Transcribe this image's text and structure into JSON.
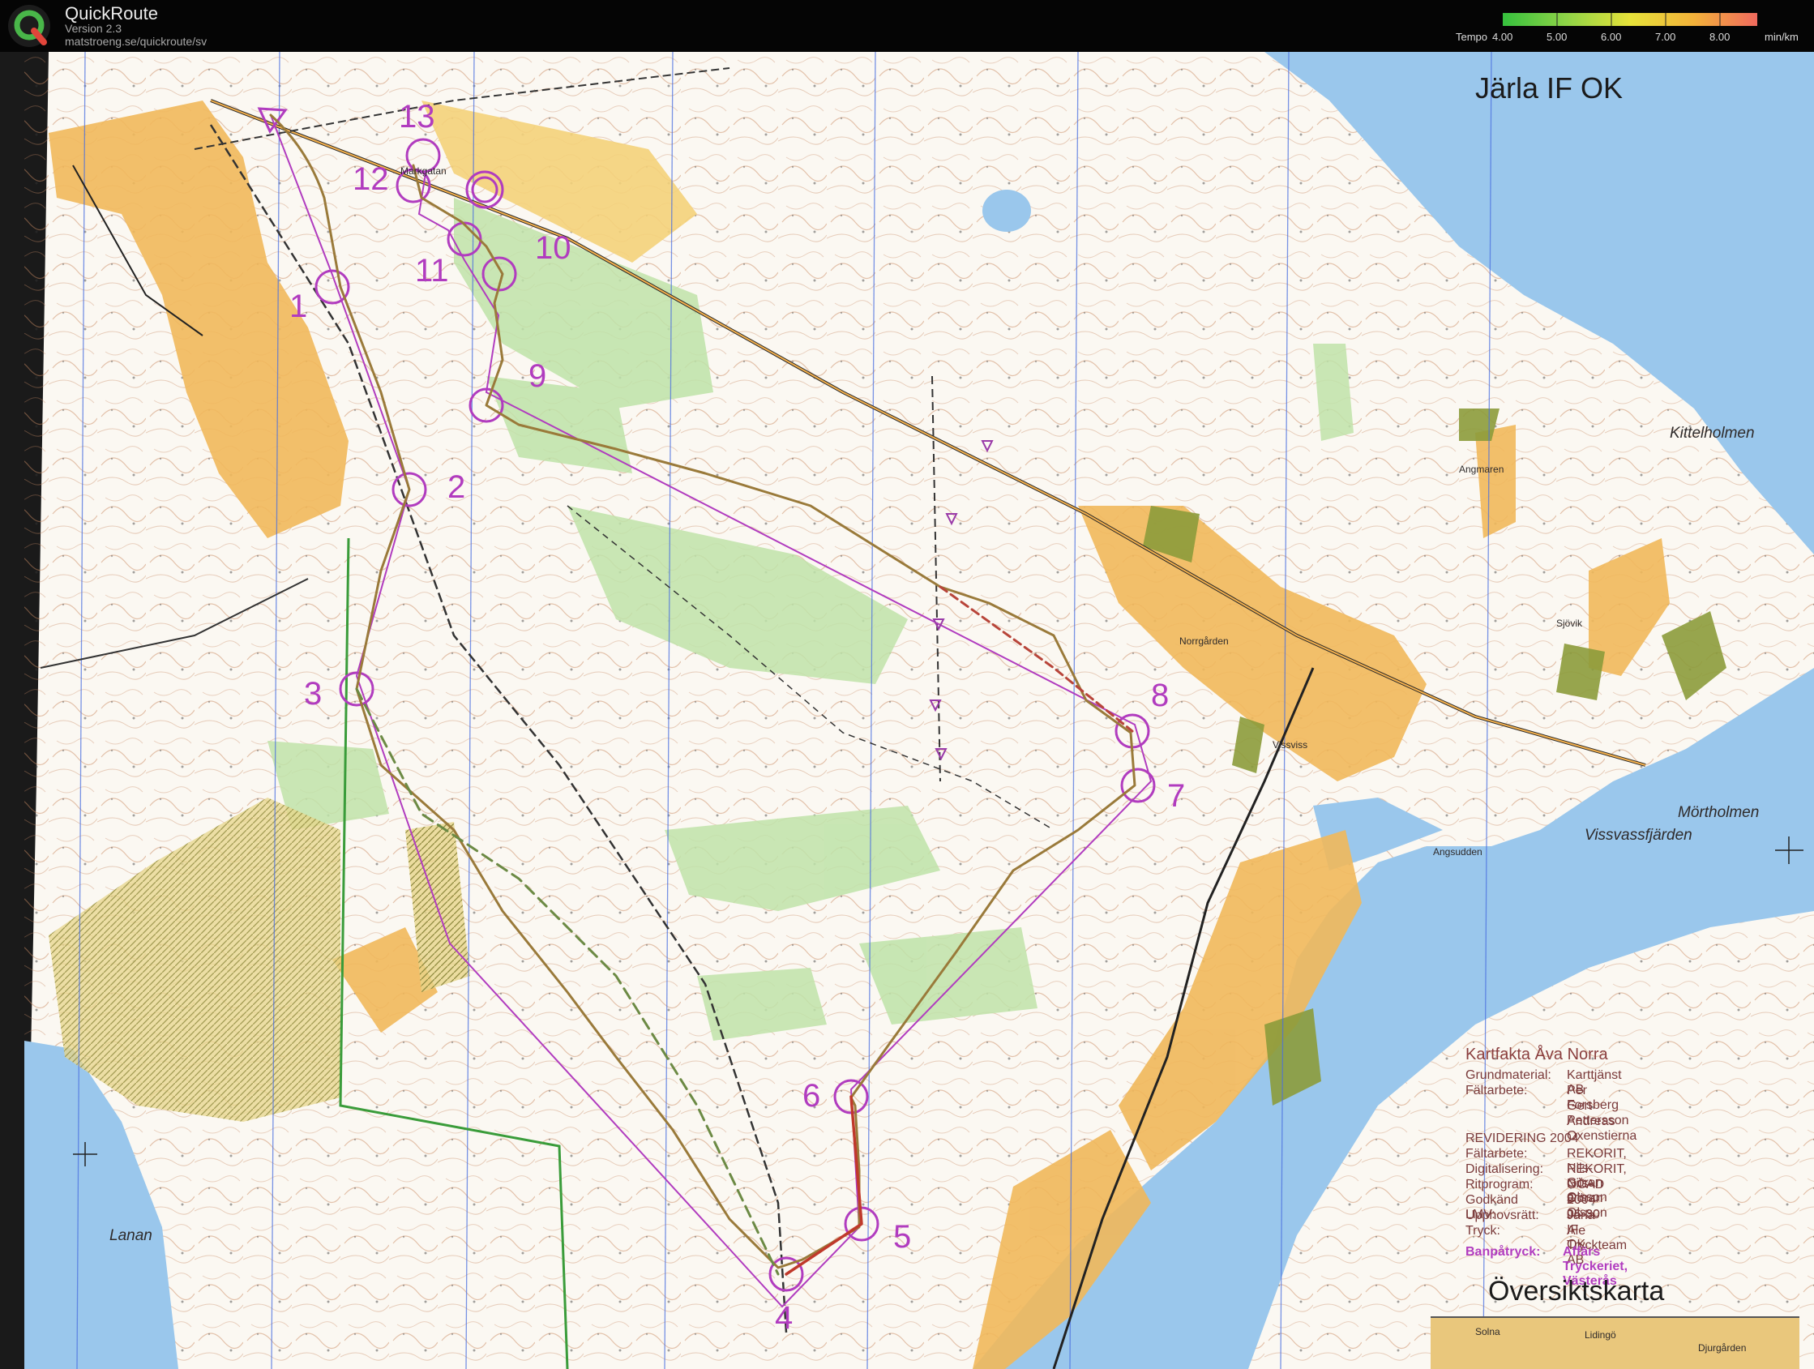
{
  "app": {
    "name": "QuickRoute",
    "version": "Version 2.3",
    "url": "matstroeng.se/quickroute/sv"
  },
  "pace_legend": {
    "label": "Tempo",
    "ticks": [
      "4.00",
      "5.00",
      "6.00",
      "7.00",
      "8.00"
    ],
    "unit": "min/km",
    "colors": [
      "#36c13e",
      "#8fd447",
      "#e6e23a",
      "#f3b23a",
      "#f06a5e"
    ]
  },
  "map": {
    "club_name": "Järla IF OK",
    "controls": [
      "1",
      "2",
      "3",
      "4",
      "5",
      "6",
      "7",
      "8",
      "9",
      "10",
      "11",
      "12",
      "13"
    ],
    "places": {
      "kittelholmen": "Kittelholmen",
      "morthholmen": "Mörtholmen",
      "vissvassfjarden": "Vissvassfjärden",
      "lanan": "Lanan",
      "angsudden": "Angsudden",
      "norrgarden": "Norrgården",
      "vissviss": "Vissviss",
      "angmaren": "Angmaren",
      "sjovik": "Sjövik",
      "markgatan": "Markgatan"
    },
    "overview": {
      "title": "Översiktskarta",
      "labels": [
        "Solna",
        "Lidingö",
        "Djurgården"
      ]
    }
  },
  "map_facts": {
    "title": "Kartfakta Åva Norra",
    "rows": [
      {
        "key": "Grundmaterial:",
        "value": "Karttjänst AB"
      },
      {
        "key": "Fältarbete:",
        "value": "Per Forsberg"
      },
      {
        "key": "",
        "value": "Gert Pettersson"
      },
      {
        "key": "",
        "value": "Andreas Oxenstierna"
      }
    ],
    "revision": "REVIDERING 2004",
    "revision_rows": [
      {
        "key": "Fältarbete:",
        "value": "REKORIT, Nils-Göran Olsson"
      },
      {
        "key": "Digitalisering:",
        "value": "REKORIT, Nils-Göran Olsson"
      },
      {
        "key": "Ritprogram:",
        "value": "OCAD 8"
      },
      {
        "key": "Godkänd LMV:",
        "value": "2004-06-30"
      },
      {
        "key": "Upphovsrätt:",
        "value": "Järla IF OK"
      },
      {
        "key": "Tryck:",
        "value": "Ale Tryckteam AB"
      }
    ],
    "course_print_key": "Banpåtryck:",
    "course_print_value": "Affärs Tryckeriet, Västerås"
  }
}
